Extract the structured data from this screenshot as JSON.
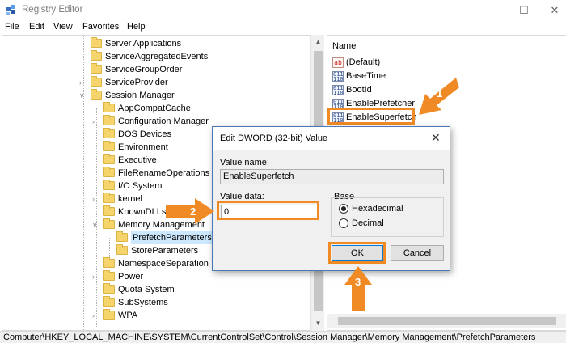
{
  "window": {
    "title": "Registry Editor"
  },
  "menubar": [
    "File",
    "Edit",
    "View",
    "Favorites",
    "Help"
  ],
  "tree": [
    {
      "label": "Server Applications",
      "level": 0,
      "chevron": ""
    },
    {
      "label": "ServiceAggregatedEvents",
      "level": 0,
      "chevron": ""
    },
    {
      "label": "ServiceGroupOrder",
      "level": 0,
      "chevron": ""
    },
    {
      "label": "ServiceProvider",
      "level": 0,
      "chevron": ">"
    },
    {
      "label": "Session Manager",
      "level": 0,
      "chevron": "v"
    },
    {
      "label": "AppCompatCache",
      "level": 1,
      "chevron": ""
    },
    {
      "label": "Configuration Manager",
      "level": 1,
      "chevron": ">"
    },
    {
      "label": "DOS Devices",
      "level": 1,
      "chevron": ""
    },
    {
      "label": "Environment",
      "level": 1,
      "chevron": ""
    },
    {
      "label": "Executive",
      "level": 1,
      "chevron": ""
    },
    {
      "label": "FileRenameOperations",
      "level": 1,
      "chevron": ""
    },
    {
      "label": "I/O System",
      "level": 1,
      "chevron": ""
    },
    {
      "label": "kernel",
      "level": 1,
      "chevron": ">"
    },
    {
      "label": "KnownDLLs",
      "level": 1,
      "chevron": ""
    },
    {
      "label": "Memory Management",
      "level": 1,
      "chevron": "v"
    },
    {
      "label": "PrefetchParameters",
      "level": 2,
      "chevron": "",
      "selected": true
    },
    {
      "label": "StoreParameters",
      "level": 2,
      "chevron": ""
    },
    {
      "label": "NamespaceSeparation",
      "level": 1,
      "chevron": ""
    },
    {
      "label": "Power",
      "level": 1,
      "chevron": ">"
    },
    {
      "label": "Quota System",
      "level": 1,
      "chevron": ""
    },
    {
      "label": "SubSystems",
      "level": 1,
      "chevron": ""
    },
    {
      "label": "WPA",
      "level": 1,
      "chevron": ">"
    }
  ],
  "values_pane": {
    "header": "Name",
    "items": [
      {
        "name": "(Default)",
        "type": "string-icon"
      },
      {
        "name": "BaseTime",
        "type": "binary-icon"
      },
      {
        "name": "BootId",
        "type": "binary-icon"
      },
      {
        "name": "EnablePrefetcher",
        "type": "binary-icon"
      },
      {
        "name": "EnableSuperfetch",
        "type": "binary-icon"
      }
    ]
  },
  "statusbar": "Computer\\HKEY_LOCAL_MACHINE\\SYSTEM\\CurrentControlSet\\Control\\Session Manager\\Memory Management\\PrefetchParameters",
  "dialog": {
    "title": "Edit DWORD (32-bit) Value",
    "value_name_label": "Value name:",
    "value_name": "EnableSuperfetch",
    "value_data_label": "Value data:",
    "value_data": "0",
    "base_label": "Base",
    "base_options": [
      "Hexadecimal",
      "Decimal"
    ],
    "base_selected": "Hexadecimal",
    "ok": "OK",
    "cancel": "Cancel"
  },
  "annotations": {
    "step1": "1",
    "step2": "2",
    "step3": "3",
    "accent_color": "#f08a24"
  },
  "colors": {
    "folder": "#f5d46b",
    "dialog_border": "#4a7ab5",
    "selection": "#cce8ff"
  }
}
